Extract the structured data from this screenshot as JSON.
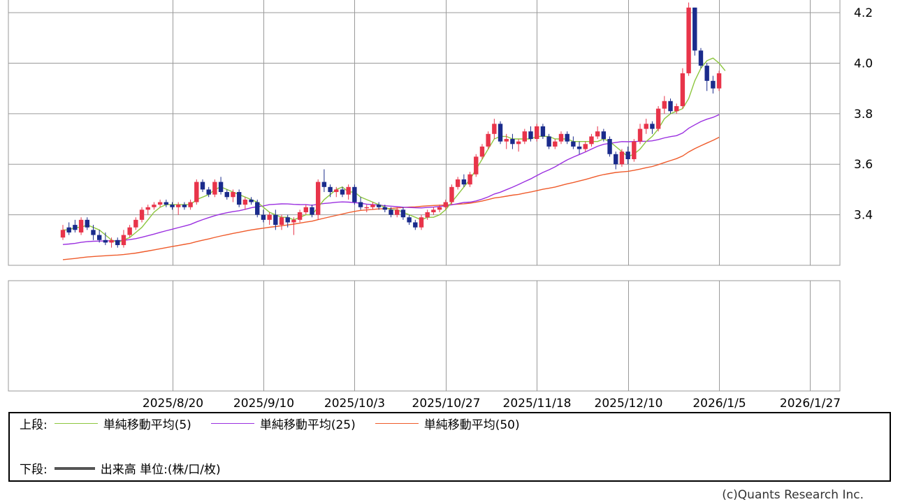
{
  "colors": {
    "up": "#e8344a",
    "down": "#1a2b8c",
    "sma5": "#8dc63f",
    "sma25": "#9b30e0",
    "sma50": "#ef5b2b",
    "grid": "#9a9a9a",
    "volume": "#555555"
  },
  "legend": {
    "upper_label": "上段:",
    "lower_label": "下段:",
    "sma5": "単純移動平均(5)",
    "sma25": "単純移動平均(25)",
    "sma50": "単純移動平均(50)",
    "volume": "出来高 単位:(株/口/枚)"
  },
  "credit": "(c)Quants Research Inc.",
  "chart_data": {
    "type": "candlestick",
    "y_ticks": [
      "3.4",
      "3.6",
      "3.8",
      "4.0",
      "4.2"
    ],
    "ylim": [
      3.2,
      4.25
    ],
    "x_tick_labels": [
      "2025/8/20",
      "2025/9/10",
      "2025/10/3",
      "2025/10/27",
      "2025/11/18",
      "2025/12/10",
      "2026/1/5",
      "2026/1/27"
    ],
    "x_tick_index": [
      18,
      33,
      48,
      63,
      78,
      93,
      108,
      123
    ],
    "candles": [
      [
        3.31,
        3.36,
        3.3,
        3.34
      ],
      [
        3.35,
        3.37,
        3.32,
        3.33
      ],
      [
        3.36,
        3.38,
        3.33,
        3.34
      ],
      [
        3.33,
        3.39,
        3.32,
        3.38
      ],
      [
        3.38,
        3.39,
        3.34,
        3.35
      ],
      [
        3.34,
        3.36,
        3.3,
        3.32
      ],
      [
        3.32,
        3.34,
        3.29,
        3.3
      ],
      [
        3.3,
        3.33,
        3.28,
        3.29
      ],
      [
        3.29,
        3.31,
        3.27,
        3.3
      ],
      [
        3.3,
        3.31,
        3.27,
        3.28
      ],
      [
        3.28,
        3.34,
        3.27,
        3.32
      ],
      [
        3.32,
        3.36,
        3.31,
        3.35
      ],
      [
        3.35,
        3.39,
        3.34,
        3.38
      ],
      [
        3.38,
        3.43,
        3.37,
        3.42
      ],
      [
        3.42,
        3.44,
        3.4,
        3.43
      ],
      [
        3.43,
        3.45,
        3.42,
        3.44
      ],
      [
        3.44,
        3.46,
        3.43,
        3.45
      ],
      [
        3.45,
        3.46,
        3.43,
        3.44
      ],
      [
        3.44,
        3.45,
        3.42,
        3.43
      ],
      [
        3.43,
        3.45,
        3.4,
        3.44
      ],
      [
        3.44,
        3.45,
        3.42,
        3.43
      ],
      [
        3.43,
        3.46,
        3.42,
        3.45
      ],
      [
        3.45,
        3.54,
        3.44,
        3.53
      ],
      [
        3.53,
        3.54,
        3.49,
        3.5
      ],
      [
        3.5,
        3.51,
        3.47,
        3.48
      ],
      [
        3.48,
        3.54,
        3.47,
        3.53
      ],
      [
        3.53,
        3.55,
        3.48,
        3.49
      ],
      [
        3.49,
        3.5,
        3.46,
        3.47
      ],
      [
        3.47,
        3.5,
        3.45,
        3.49
      ],
      [
        3.49,
        3.5,
        3.43,
        3.44
      ],
      [
        3.44,
        3.47,
        3.42,
        3.46
      ],
      [
        3.46,
        3.47,
        3.44,
        3.45
      ],
      [
        3.45,
        3.46,
        3.39,
        3.4
      ],
      [
        3.4,
        3.42,
        3.37,
        3.38
      ],
      [
        3.38,
        3.41,
        3.36,
        3.4
      ],
      [
        3.4,
        3.42,
        3.34,
        3.36
      ],
      [
        3.36,
        3.4,
        3.34,
        3.39
      ],
      [
        3.39,
        3.4,
        3.35,
        3.37
      ],
      [
        3.37,
        3.39,
        3.32,
        3.38
      ],
      [
        3.38,
        3.42,
        3.37,
        3.41
      ],
      [
        3.41,
        3.44,
        3.4,
        3.43
      ],
      [
        3.43,
        3.44,
        3.39,
        3.4
      ],
      [
        3.4,
        3.54,
        3.38,
        3.53
      ],
      [
        3.53,
        3.58,
        3.49,
        3.51
      ],
      [
        3.51,
        3.52,
        3.47,
        3.49
      ],
      [
        3.49,
        3.51,
        3.47,
        3.5
      ],
      [
        3.5,
        3.51,
        3.47,
        3.48
      ],
      [
        3.48,
        3.52,
        3.46,
        3.51
      ],
      [
        3.51,
        3.52,
        3.44,
        3.45
      ],
      [
        3.45,
        3.47,
        3.42,
        3.43
      ],
      [
        3.43,
        3.44,
        3.41,
        3.43
      ],
      [
        3.43,
        3.45,
        3.42,
        3.44
      ],
      [
        3.44,
        3.45,
        3.42,
        3.43
      ],
      [
        3.43,
        3.44,
        3.41,
        3.42
      ],
      [
        3.42,
        3.43,
        3.39,
        3.4
      ],
      [
        3.4,
        3.43,
        3.39,
        3.42
      ],
      [
        3.42,
        3.43,
        3.38,
        3.39
      ],
      [
        3.39,
        3.4,
        3.36,
        3.37
      ],
      [
        3.37,
        3.38,
        3.34,
        3.35
      ],
      [
        3.35,
        3.4,
        3.34,
        3.39
      ],
      [
        3.39,
        3.42,
        3.38,
        3.41
      ],
      [
        3.41,
        3.43,
        3.4,
        3.42
      ],
      [
        3.42,
        3.44,
        3.41,
        3.43
      ],
      [
        3.43,
        3.46,
        3.42,
        3.45
      ],
      [
        3.45,
        3.52,
        3.44,
        3.51
      ],
      [
        3.51,
        3.55,
        3.5,
        3.54
      ],
      [
        3.54,
        3.56,
        3.51,
        3.52
      ],
      [
        3.52,
        3.57,
        3.51,
        3.56
      ],
      [
        3.56,
        3.64,
        3.55,
        3.63
      ],
      [
        3.63,
        3.68,
        3.62,
        3.67
      ],
      [
        3.67,
        3.73,
        3.66,
        3.72
      ],
      [
        3.72,
        3.78,
        3.7,
        3.76
      ],
      [
        3.76,
        3.77,
        3.68,
        3.69
      ],
      [
        3.69,
        3.72,
        3.66,
        3.7
      ],
      [
        3.7,
        3.72,
        3.66,
        3.68
      ],
      [
        3.68,
        3.7,
        3.65,
        3.69
      ],
      [
        3.69,
        3.74,
        3.68,
        3.73
      ],
      [
        3.73,
        3.75,
        3.69,
        3.7
      ],
      [
        3.7,
        3.76,
        3.69,
        3.75
      ],
      [
        3.75,
        3.76,
        3.7,
        3.71
      ],
      [
        3.71,
        3.72,
        3.66,
        3.67
      ],
      [
        3.67,
        3.7,
        3.66,
        3.69
      ],
      [
        3.69,
        3.73,
        3.68,
        3.72
      ],
      [
        3.72,
        3.73,
        3.68,
        3.69
      ],
      [
        3.69,
        3.71,
        3.66,
        3.67
      ],
      [
        3.67,
        3.69,
        3.64,
        3.66
      ],
      [
        3.66,
        3.69,
        3.65,
        3.68
      ],
      [
        3.68,
        3.72,
        3.67,
        3.71
      ],
      [
        3.71,
        3.75,
        3.7,
        3.73
      ],
      [
        3.73,
        3.74,
        3.69,
        3.7
      ],
      [
        3.7,
        3.71,
        3.63,
        3.64
      ],
      [
        3.64,
        3.65,
        3.58,
        3.6
      ],
      [
        3.6,
        3.66,
        3.59,
        3.65
      ],
      [
        3.65,
        3.67,
        3.6,
        3.62
      ],
      [
        3.62,
        3.7,
        3.61,
        3.69
      ],
      [
        3.69,
        3.76,
        3.68,
        3.74
      ],
      [
        3.74,
        3.78,
        3.72,
        3.76
      ],
      [
        3.76,
        3.77,
        3.72,
        3.74
      ],
      [
        3.74,
        3.83,
        3.73,
        3.82
      ],
      [
        3.82,
        3.87,
        3.8,
        3.85
      ],
      [
        3.85,
        3.86,
        3.8,
        3.81
      ],
      [
        3.81,
        3.84,
        3.8,
        3.83
      ],
      [
        3.83,
        3.98,
        3.82,
        3.96
      ],
      [
        3.96,
        4.24,
        3.95,
        4.22
      ],
      [
        4.22,
        4.22,
        4.03,
        4.05
      ],
      [
        4.05,
        4.06,
        3.98,
        3.99
      ],
      [
        3.99,
        4.0,
        3.89,
        3.93
      ],
      [
        3.93,
        3.95,
        3.88,
        3.9
      ],
      [
        3.9,
        3.97,
        3.89,
        3.96
      ]
    ],
    "sma5": [
      3.34,
      3.34,
      3.35,
      3.35,
      3.36,
      3.35,
      3.34,
      3.32,
      3.3,
      3.29,
      3.3,
      3.31,
      3.33,
      3.35,
      3.38,
      3.41,
      3.43,
      3.44,
      3.44,
      3.44,
      3.44,
      3.44,
      3.46,
      3.47,
      3.48,
      3.5,
      3.51,
      3.5,
      3.49,
      3.48,
      3.47,
      3.46,
      3.45,
      3.43,
      3.41,
      3.4,
      3.39,
      3.39,
      3.38,
      3.39,
      3.4,
      3.4,
      3.43,
      3.46,
      3.48,
      3.5,
      3.51,
      3.49,
      3.49,
      3.47,
      3.46,
      3.45,
      3.44,
      3.43,
      3.42,
      3.42,
      3.41,
      3.4,
      3.39,
      3.38,
      3.39,
      3.39,
      3.4,
      3.42,
      3.45,
      3.48,
      3.51,
      3.54,
      3.58,
      3.62,
      3.66,
      3.7,
      3.71,
      3.71,
      3.7,
      3.7,
      3.7,
      3.7,
      3.71,
      3.71,
      3.71,
      3.7,
      3.7,
      3.7,
      3.69,
      3.69,
      3.69,
      3.69,
      3.69,
      3.7,
      3.69,
      3.67,
      3.65,
      3.63,
      3.64,
      3.66,
      3.69,
      3.71,
      3.74,
      3.78,
      3.8,
      3.81,
      3.82,
      3.86,
      3.93,
      3.98,
      4.01,
      4.02,
      4.0,
      3.97
    ]
  }
}
